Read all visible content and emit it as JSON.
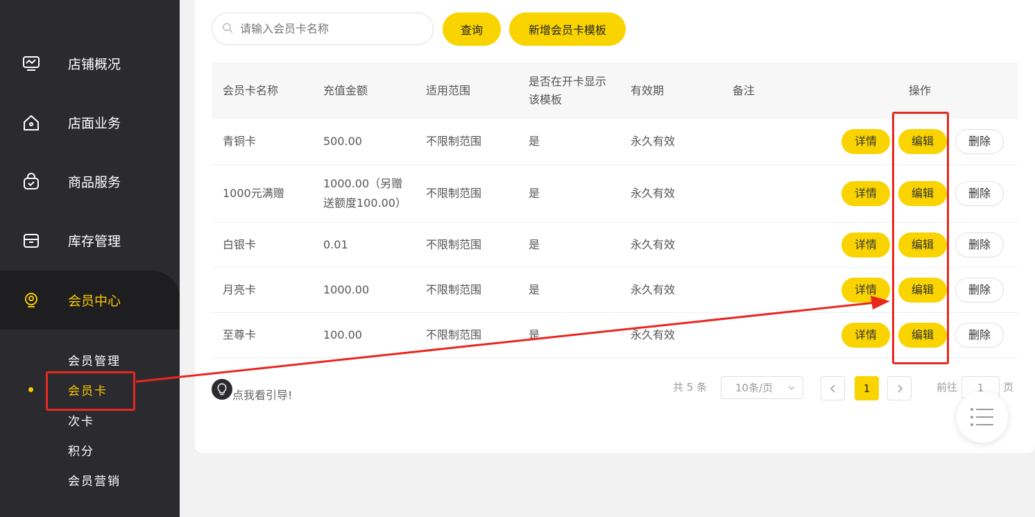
{
  "sidebar": {
    "items": [
      {
        "label": "店铺概况",
        "icon": "monitor-icon"
      },
      {
        "label": "店面业务",
        "icon": "home-icon"
      },
      {
        "label": "商品服务",
        "icon": "bag-icon"
      },
      {
        "label": "库存管理",
        "icon": "archive-icon"
      },
      {
        "label": "会员中心",
        "icon": "member-icon"
      }
    ],
    "sub_items": [
      "会员管理",
      "会员卡",
      "次卡",
      "积分",
      "会员营销"
    ],
    "active_sub": "会员卡"
  },
  "toolbar": {
    "search_placeholder": "请输入会员卡名称",
    "query_label": "查询",
    "add_label": "新增会员卡模板"
  },
  "table": {
    "headers": [
      "会员卡名称",
      "充值金额",
      "适用范围",
      "是否在开卡显示该模板",
      "有效期",
      "备注",
      "操作"
    ],
    "rows": [
      {
        "name": "青铜卡",
        "amount": "500.00",
        "scope": "不限制范围",
        "show": "是",
        "validity": "永久有效",
        "remark": ""
      },
      {
        "name": "1000元满赠",
        "amount": "1000.00（另赠送额度100.00）",
        "scope": "不限制范围",
        "show": "是",
        "validity": "永久有效",
        "remark": ""
      },
      {
        "name": "白银卡",
        "amount": "0.01",
        "scope": "不限制范围",
        "show": "是",
        "validity": "永久有效",
        "remark": ""
      },
      {
        "name": "月亮卡",
        "amount": "1000.00",
        "scope": "不限制范围",
        "show": "是",
        "validity": "永久有效",
        "remark": ""
      },
      {
        "name": "至尊卡",
        "amount": "100.00",
        "scope": "不限制范围",
        "show": "是",
        "validity": "永久有效",
        "remark": ""
      }
    ],
    "actions": {
      "detail": "详情",
      "edit": "编辑",
      "delete": "删除"
    }
  },
  "guide": {
    "label": "点我看引导!"
  },
  "pagination": {
    "total": "共 5 条",
    "page_size": "10条/页",
    "current": "1",
    "goto_prefix": "前往",
    "goto_value": "1",
    "goto_suffix": "页"
  },
  "colors": {
    "accent": "#f9d400",
    "sidebar": "#2b2b2f",
    "annotation": "#e8271f"
  }
}
